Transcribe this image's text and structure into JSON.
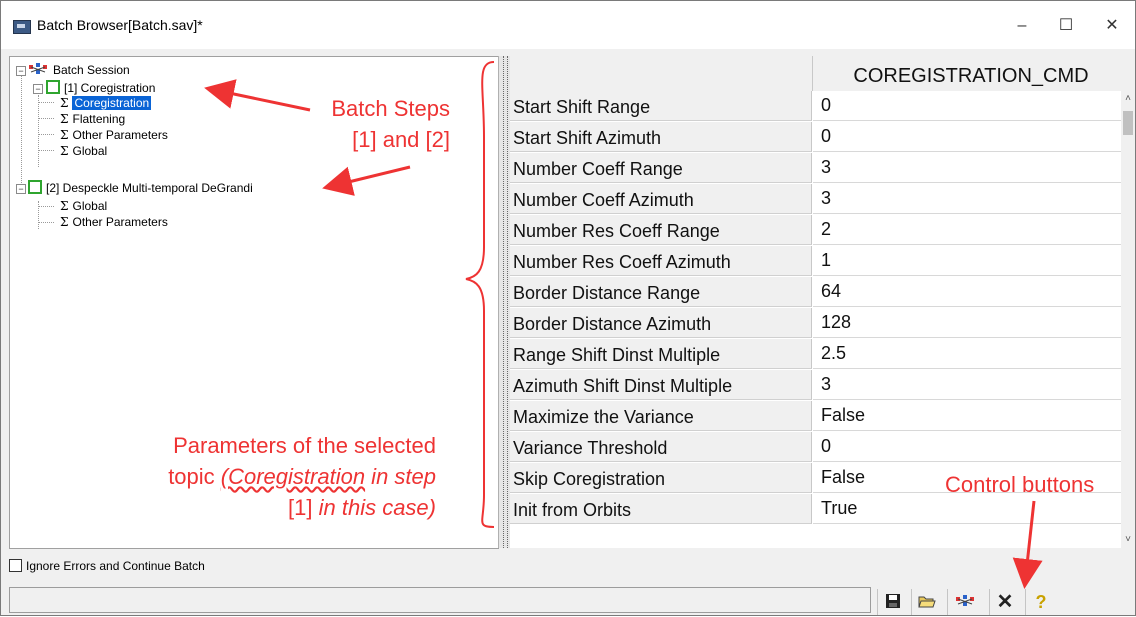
{
  "window": {
    "title": "Batch Browser[Batch.sav]*",
    "min_glyph": "–",
    "max_glyph": "☐",
    "close_glyph": "✕"
  },
  "tree": {
    "root": "Batch Session",
    "steps": [
      {
        "label": "[1] Coregistration",
        "children": [
          "Coregistration",
          "Flattening",
          "Other Parameters",
          "Global"
        ]
      },
      {
        "label": "[2] Despeckle Multi-temporal DeGrandi",
        "children": [
          "Global",
          "Other Parameters"
        ]
      }
    ],
    "selected": "Coregistration"
  },
  "grid": {
    "column_header": "COREGISTRATION_CMD",
    "rows": [
      {
        "name": "Start Shift Range",
        "value": "0"
      },
      {
        "name": "Start Shift Azimuth",
        "value": "0"
      },
      {
        "name": "Number Coeff Range",
        "value": "3"
      },
      {
        "name": "Number Coeff Azimuth",
        "value": "3"
      },
      {
        "name": "Number Res Coeff Range",
        "value": "2"
      },
      {
        "name": "Number Res Coeff Azimuth",
        "value": "1"
      },
      {
        "name": "Border Distance Range",
        "value": "64"
      },
      {
        "name": "Border Distance Azimuth",
        "value": "128"
      },
      {
        "name": "Range Shift Dinst Multiple",
        "value": "2.5"
      },
      {
        "name": "Azimuth Shift Dinst Multiple",
        "value": "3"
      },
      {
        "name": "Maximize the Variance",
        "value": "False"
      },
      {
        "name": "Variance Threshold",
        "value": "0"
      },
      {
        "name": "Skip Coregistration",
        "value": "False"
      },
      {
        "name": "Init from Orbits",
        "value": "True"
      }
    ]
  },
  "annotations": {
    "batch_steps_line1": "Batch Steps",
    "batch_steps_line2": "[1] and [2]",
    "params_line1": "Parameters of the selected",
    "params_line2_a": "topic ",
    "params_line2_b": "(Coregistration",
    "params_line2_c": " in step",
    "params_line3_a": "[1] ",
    "params_line3_b": "in this case)",
    "control_buttons": "Control buttons",
    "color": "#e33333"
  },
  "ignore_errors_label": "Ignore Errors and Continue Batch",
  "control_buttons": [
    {
      "name": "save",
      "glyph": "💾"
    },
    {
      "name": "open",
      "glyph": "📂"
    },
    {
      "name": "run",
      "glyph": "✱"
    },
    {
      "name": "cancel",
      "glyph": "✕"
    },
    {
      "name": "help",
      "glyph": "?"
    }
  ]
}
